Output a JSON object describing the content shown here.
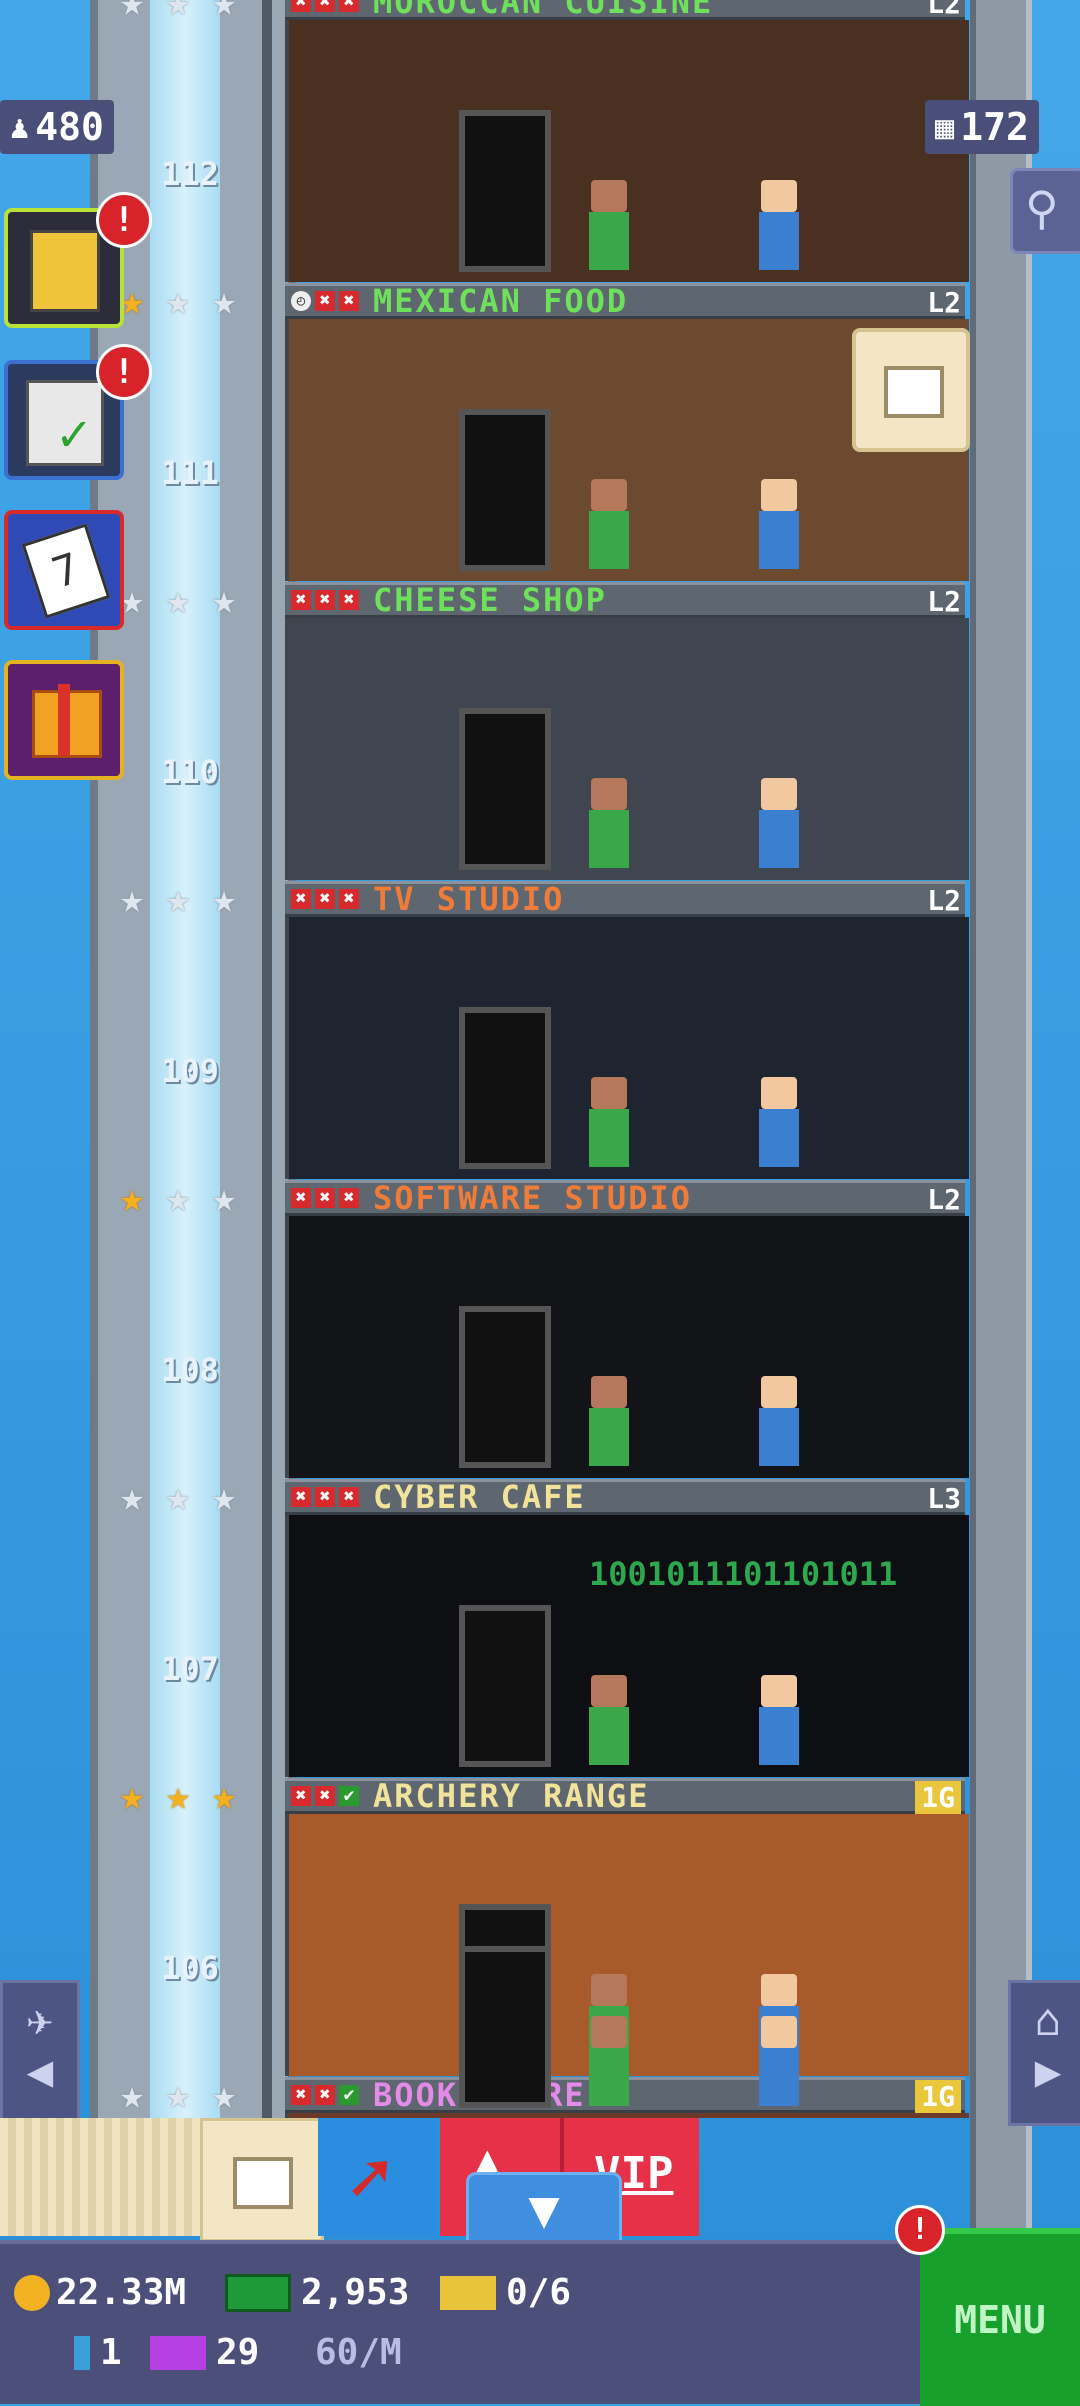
{
  "top_stats": {
    "population": "480",
    "floors": "172"
  },
  "floors": [
    {
      "number": "112",
      "name": "MOROCCAN CUISINE",
      "name_color": "#6fe05c",
      "level": "L2",
      "level_gold": false,
      "stars_gold": 0,
      "status": [
        "x",
        "x",
        "x"
      ]
    },
    {
      "number": "111",
      "name": "MEXICAN FOOD",
      "name_color": "#6fe05c",
      "level": "L2",
      "level_gold": false,
      "stars_gold": 1,
      "status": [
        "clk",
        "x",
        "x"
      ]
    },
    {
      "number": "110",
      "name": "CHEESE SHOP",
      "name_color": "#6fe05c",
      "level": "L2",
      "level_gold": false,
      "stars_gold": 0,
      "status": [
        "x",
        "x",
        "x"
      ]
    },
    {
      "number": "109",
      "name": "TV STUDIO",
      "name_color": "#f07c3a",
      "level": "L2",
      "level_gold": false,
      "stars_gold": 0,
      "status": [
        "x",
        "x",
        "x"
      ]
    },
    {
      "number": "108",
      "name": "SOFTWARE STUDIO",
      "name_color": "#f07c3a",
      "level": "L2",
      "level_gold": false,
      "stars_gold": 1,
      "status": [
        "x",
        "x",
        "x"
      ]
    },
    {
      "number": "107",
      "name": "CYBER CAFE",
      "name_color": "#f2e39a",
      "level": "L3",
      "level_gold": false,
      "stars_gold": 0,
      "status": [
        "x",
        "x",
        "x"
      ]
    },
    {
      "number": "106",
      "name": "ARCHERY RANGE",
      "name_color": "#f2e39a",
      "level": "1G",
      "level_gold": true,
      "stars_gold": 3,
      "status": [
        "x",
        "x",
        "c"
      ]
    },
    {
      "number": "",
      "name": "BOOK STORE",
      "name_color": "#e48ae8",
      "level": "1G",
      "level_gold": true,
      "stars_gold": 0,
      "status": [
        "x",
        "x",
        "c"
      ]
    }
  ],
  "cyber_cafe_sign": "1001011101101011",
  "side_icons": [
    {
      "name": "tower-icon",
      "badge": "!"
    },
    {
      "name": "checklist-icon",
      "badge": "!"
    },
    {
      "name": "calendar-icon",
      "badge": ""
    },
    {
      "name": "gift-icon",
      "badge": ""
    }
  ],
  "bottom": {
    "coins": "22.33M",
    "bux": "2,953",
    "tickets": "0/6",
    "elevators": "1",
    "vip": "29",
    "rate": "60/M",
    "menu_label": "MENU",
    "vip_label": "VIP",
    "menu_badge": "!"
  },
  "colors": {
    "sky": "#3aa0e0",
    "menu_green": "#18a02c",
    "bar_purple": "#4c4f7a"
  }
}
